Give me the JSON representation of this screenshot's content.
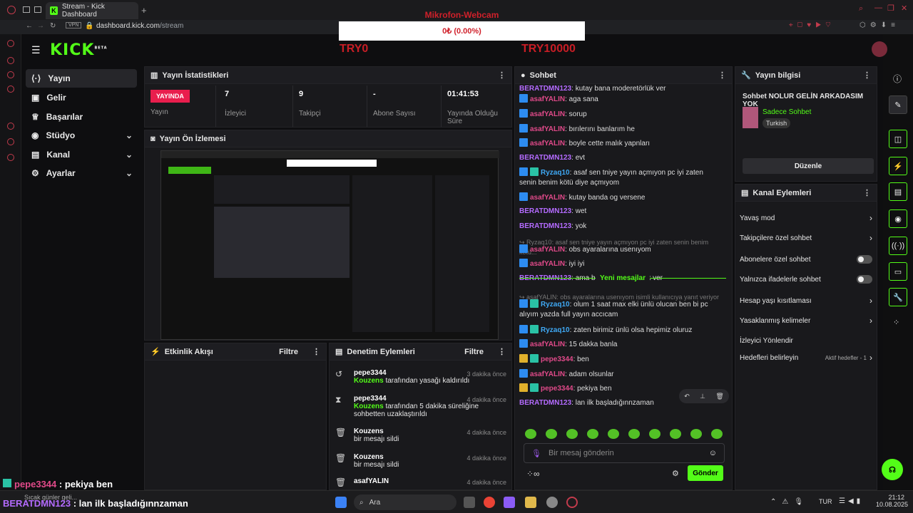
{
  "browser": {
    "tab_title": "Stream - Kick Dashboard",
    "vpn": "VPN",
    "url_domain": "dashboard.kick.com",
    "url_path": "/stream"
  },
  "overlay": {
    "title": "Mikrofon-Webcam",
    "amount": "0₺ (0.00%)",
    "goal_min": "TRY0",
    "goal_max": "TRY10000"
  },
  "app": {
    "logo": "KICK",
    "logo_beta": "BETA"
  },
  "nav": [
    {
      "label": "Yayın",
      "icon": "broadcast-icon"
    },
    {
      "label": "Gelir",
      "icon": "money-icon"
    },
    {
      "label": "Başarılar",
      "icon": "trophy-icon"
    },
    {
      "label": "Stüdyo",
      "icon": "studio-icon"
    },
    {
      "label": "Kanal",
      "icon": "channel-icon"
    },
    {
      "label": "Ayarlar",
      "icon": "gear-icon"
    }
  ],
  "stats": {
    "title": "Yayın İstatistikleri",
    "live_badge": "YAYINDA",
    "items": [
      {
        "value": "7",
        "label": "İzleyici"
      },
      {
        "value": "9",
        "label": "Takipçi"
      },
      {
        "value": "-",
        "label": "Abone Sayısı"
      },
      {
        "value": "01:41:53",
        "label": "Yayında Olduğu Süre"
      }
    ],
    "live_label": "Yayın"
  },
  "preview": {
    "title": "Yayın Ön İzlemesi"
  },
  "activity": {
    "title": "Etkinlik Akışı",
    "filter": "Filtre"
  },
  "moderation": {
    "title": "Denetim Eylemleri",
    "filter": "Filtre",
    "items": [
      {
        "user": "pepe3344",
        "actor": "Kouzens",
        "desc": " tarafından yasağı kaldırıldı",
        "time": "3 dakika önce",
        "icon": "undo-icon"
      },
      {
        "user": "pepe3344",
        "actor": "Kouzens",
        "desc": " tarafından 5 dakika süreliğine sohbetten uzaklaştırıldı",
        "time": "4 dakika önce",
        "icon": "hourglass-icon"
      },
      {
        "user": "Kouzens",
        "actor": "",
        "desc": "bir mesajı sildi",
        "time": "4 dakika önce",
        "icon": "trash-icon"
      },
      {
        "user": "Kouzens",
        "actor": "",
        "desc": "bir mesajı sildi",
        "time": "4 dakika önce",
        "icon": "trash-icon"
      },
      {
        "user": "asafYALIN",
        "actor": "",
        "desc": "",
        "time": "4 dakika önce",
        "icon": "trash-icon"
      }
    ]
  },
  "chat": {
    "title": "Sohbet",
    "new_messages": "Yeni mesajlar",
    "input_placeholder": "Bir mesaj gönderin",
    "send": "Gönder",
    "messages": [
      {
        "user": "BERATDMN123",
        "text": ": kutay bana moderetörlük ver",
        "color": "#b46bff",
        "badge": ""
      },
      {
        "user": "asafYALIN",
        "text": ": aga sana",
        "color": "#e14a8a",
        "badge": "b"
      },
      {
        "user": "asafYALIN",
        "text": ": sorup",
        "color": "#e14a8a",
        "badge": "b"
      },
      {
        "user": "asafYALIN",
        "text": ": bırılerını banlarım he",
        "color": "#e14a8a",
        "badge": "b"
      },
      {
        "user": "asafYALIN",
        "text": ": boyle cette malık yapnları",
        "color": "#e14a8a",
        "badge": "b"
      },
      {
        "user": "BERATDMN123",
        "text": ": evt",
        "color": "#b46bff",
        "badge": ""
      },
      {
        "user": "Ryzaq10",
        "text": ": asaf sen tniye yayın açmıyon pc iyi zaten senin benim kötü diye açmıyom",
        "color": "#3fa9f5",
        "badge": "bt"
      },
      {
        "user": "asafYALIN",
        "text": ": kutay banda og versene",
        "color": "#e14a8a",
        "badge": "b"
      },
      {
        "user": "BERATDMN123",
        "text": ": wet",
        "color": "#b46bff",
        "badge": ""
      },
      {
        "user": "BERATDMN123",
        "text": ": yok",
        "color": "#b46bff",
        "badge": ""
      },
      {
        "user": "",
        "text": "↪ Ryzaq10: asaf sen tniye yayın açmıyon pc iyi zaten senin benim kötü...",
        "color": "#777",
        "badge": ""
      },
      {
        "user": "asafYALIN",
        "text": ": obs ayaralarına usenıyom",
        "color": "#e14a8a",
        "badge": "b"
      },
      {
        "user": "asafYALIN",
        "text": ": iyi iyi",
        "color": "#e14a8a",
        "badge": "b"
      },
      {
        "user": "BERATDMN123",
        "text": ": ama bana moderetörlük ver",
        "color": "#b46bff",
        "badge": ""
      },
      {
        "user": "",
        "text": "↪ asafYALIN: obs ayaralarına usenıyom isimli kullanıcıya yanıt veriyor",
        "color": "#777",
        "badge": ""
      },
      {
        "user": "Ryzaq10",
        "text": ": olum 1 saat max elki ünlü olucan ben bi pc alıyım yazda full yayın accıcam",
        "color": "#3fa9f5",
        "badge": "bt"
      },
      {
        "user": "Ryzaq10",
        "text": ": zaten birimiz ünlü olsa hepimiz oluruz",
        "color": "#3fa9f5",
        "badge": "bt"
      },
      {
        "user": "asafYALIN",
        "text": ": 15 dakka banla",
        "color": "#e14a8a",
        "badge": "b"
      },
      {
        "user": "pepe3344",
        "text": ": ben",
        "color": "#e14a8a",
        "badge": "ct"
      },
      {
        "user": "asafYALIN",
        "text": ": adam olsunlar",
        "color": "#e14a8a",
        "badge": "b"
      },
      {
        "user": "pepe3344",
        "text": ": pekiya ben",
        "color": "#e14a8a",
        "badge": "ct"
      },
      {
        "user": "BERATDMN123",
        "text": ": lan ilk başladığınnzaman",
        "color": "#b46bff",
        "badge": ""
      }
    ]
  },
  "stream_info": {
    "title": "Yayın bilgisi",
    "stream_title": "Sohbet NOLUR GELİN ARKADASIM YOK",
    "category": "Sadece Sohbet",
    "tag": "Turkish",
    "edit": "Düzenle"
  },
  "channel_actions": {
    "title": "Kanal Eylemleri",
    "items": [
      {
        "label": "Yavaş mod",
        "control": "chevron"
      },
      {
        "label": "Takipçilere özel sohbet",
        "control": "chevron"
      },
      {
        "label": "Abonelere özel sohbet",
        "control": "toggle"
      },
      {
        "label": "Yalnızca ifadelerle sohbet",
        "control": "toggle"
      },
      {
        "label": "Hesap yaşı kısıtlaması",
        "control": "chevron"
      },
      {
        "label": "Yasaklanmış kelimeler",
        "control": "chevron"
      },
      {
        "label": "İzleyici Yönlendir",
        "control": "none"
      },
      {
        "label": "Hedefleri belirleyin",
        "control": "chevron",
        "extra": "Aktif hedefler - 1"
      }
    ]
  },
  "overlay_chat": [
    {
      "user": "pepe3344",
      "text": " : pekiya ben"
    },
    {
      "user": "BERATDMN123",
      "text": " : lan ilk başladığınnzaman"
    }
  ],
  "taskbar": {
    "search": "Ara",
    "weather": "Sıcak günler geli...",
    "lang": "TUR",
    "time": "21:12",
    "date": "10.08.2025"
  }
}
